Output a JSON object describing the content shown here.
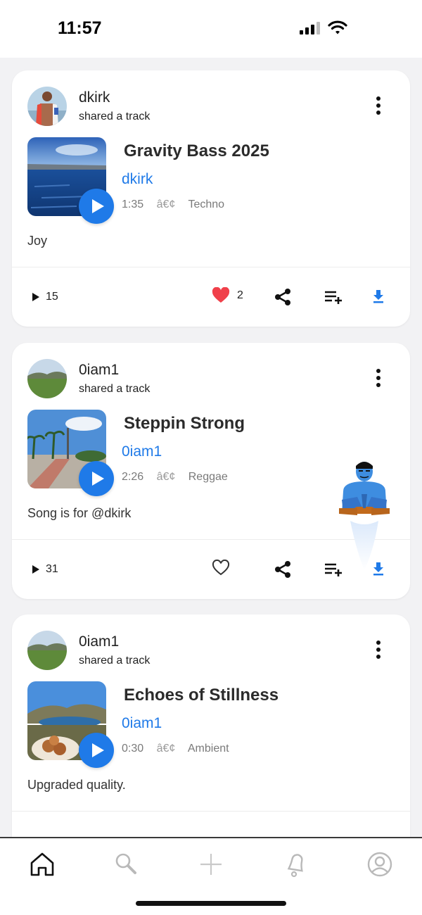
{
  "status_bar": {
    "time": "11:57"
  },
  "colors": {
    "accent": "#1f7ae8",
    "like_active": "#f0404a"
  },
  "posts": [
    {
      "username": "dkirk",
      "action": "shared a track",
      "track_title": "Gravity Bass 2025",
      "artist": "dkirk",
      "duration": "1:35",
      "separator": "â€¢",
      "genre": "Techno",
      "caption": "Joy",
      "plays": "15",
      "likes": "2",
      "liked": true
    },
    {
      "username": "0iam1",
      "action": "shared a track",
      "track_title": "Steppin Strong",
      "artist": "0iam1",
      "duration": "2:26",
      "separator": "â€¢",
      "genre": "Reggae",
      "caption": "Song is for @dkirk",
      "plays": "31",
      "likes": "",
      "liked": false
    },
    {
      "username": "0iam1",
      "action": "shared a track",
      "track_title": "Echoes of Stillness",
      "artist": "0iam1",
      "duration": "0:30",
      "separator": "â€¢",
      "genre": "Ambient",
      "caption": "Upgraded quality.",
      "plays": "",
      "likes": "",
      "liked": false
    }
  ],
  "tab_bar": {
    "tabs": [
      {
        "icon": "home-icon",
        "active": true
      },
      {
        "icon": "search-icon",
        "active": false
      },
      {
        "icon": "plus-icon",
        "active": false
      },
      {
        "icon": "bell-icon",
        "active": false
      },
      {
        "icon": "profile-icon",
        "active": false
      }
    ]
  }
}
